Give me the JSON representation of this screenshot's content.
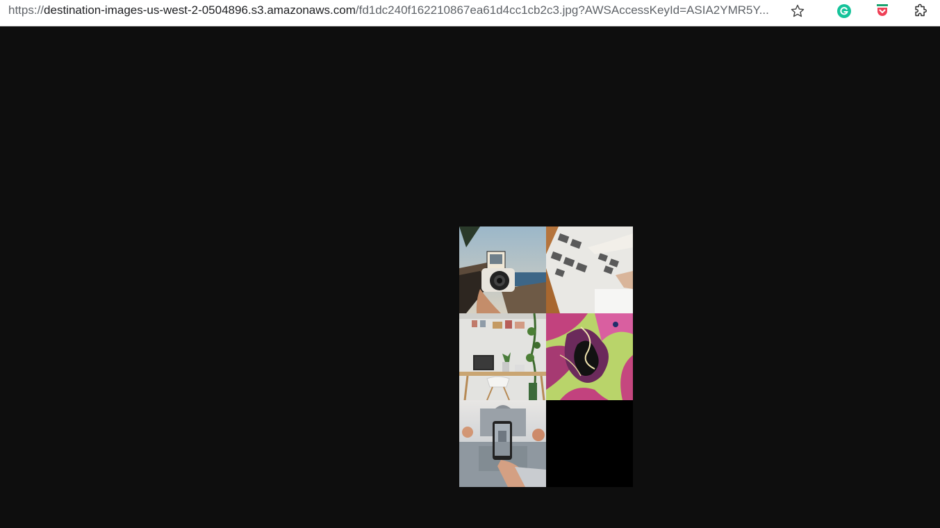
{
  "browser": {
    "url_host_prefix": "https://",
    "url_host": "destination-images-us-west-2-0504896.s3.amazonaws.com",
    "url_rest": "/fd1dc240f162210867ea61d4cc1cb2c3.jpg?AWSAccessKeyId=ASIA2YMR5Y...",
    "icons": [
      "star-icon",
      "grammarly-icon",
      "pocket-icon",
      "puzzle-icon"
    ]
  },
  "viewer": {
    "background": "#0e0e0e",
    "tiles": [
      {
        "name": "camera-waterfront-photo"
      },
      {
        "name": "photo-prints-table-photo"
      },
      {
        "name": "desk-workspace-photo"
      },
      {
        "name": "abstract-marble-art"
      },
      {
        "name": "phone-reflection-photo"
      },
      {
        "name": "empty-black-tile"
      }
    ]
  },
  "colors": {
    "grammarly": "#15c39a",
    "pocket": "#ef4056"
  }
}
